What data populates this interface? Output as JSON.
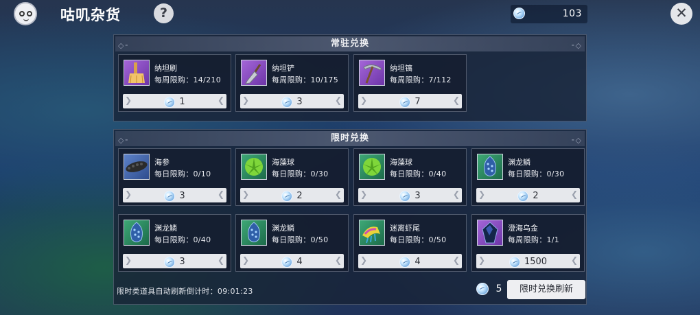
{
  "header": {
    "title": "咕叽杂货",
    "help_label": "?",
    "currency_amount": "103",
    "close_label": "✕"
  },
  "permanent": {
    "title": "常驻兑换",
    "items": [
      {
        "name": "纳坦刷",
        "limit": "每周限购：14/210",
        "price": "1",
        "icon": "brush-icon",
        "color": "purple"
      },
      {
        "name": "纳坦铲",
        "limit": "每周限购：10/175",
        "price": "3",
        "icon": "trowel-icon",
        "color": "purple"
      },
      {
        "name": "纳坦镐",
        "limit": "每周限购：7/112",
        "price": "7",
        "icon": "pickaxe-icon",
        "color": "purple"
      }
    ]
  },
  "limited": {
    "title": "限时兑换",
    "items": [
      {
        "name": "海参",
        "limit": "每日限购：0/10",
        "price": "3",
        "icon": "sea-cucumber-icon",
        "color": "blue"
      },
      {
        "name": "海藻球",
        "limit": "每日限购：0/30",
        "price": "2",
        "icon": "seaweed-ball-icon",
        "color": "green"
      },
      {
        "name": "海藻球",
        "limit": "每日限购：0/40",
        "price": "3",
        "icon": "seaweed-ball-icon",
        "color": "green"
      },
      {
        "name": "渊龙鳞",
        "limit": "每日限购：0/30",
        "price": "2",
        "icon": "dragon-scale-icon",
        "color": "green"
      },
      {
        "name": "渊龙鳞",
        "limit": "每日限购：0/40",
        "price": "3",
        "icon": "dragon-scale-icon",
        "color": "green"
      },
      {
        "name": "渊龙鳞",
        "limit": "每日限购：0/50",
        "price": "4",
        "icon": "dragon-scale-icon",
        "color": "green"
      },
      {
        "name": "迷离虾尾",
        "limit": "每日限购：0/50",
        "price": "4",
        "icon": "shrimp-tail-icon",
        "color": "green"
      },
      {
        "name": "澄海乌金",
        "limit": "每周限购：1/1",
        "price": "1500",
        "icon": "dark-gold-icon",
        "color": "purple"
      }
    ]
  },
  "footer": {
    "countdown": "限时类道具自动刷新倒计时：09:01:23",
    "refresh_cost": "5",
    "refresh_button": "限时兑换刷新"
  },
  "colors": {
    "panel": "#19233a",
    "price_bar": "#e6e8ec",
    "purple_icon": "#8a4fc4",
    "green_icon": "#2f8f62",
    "blue_icon": "#4566a8"
  }
}
